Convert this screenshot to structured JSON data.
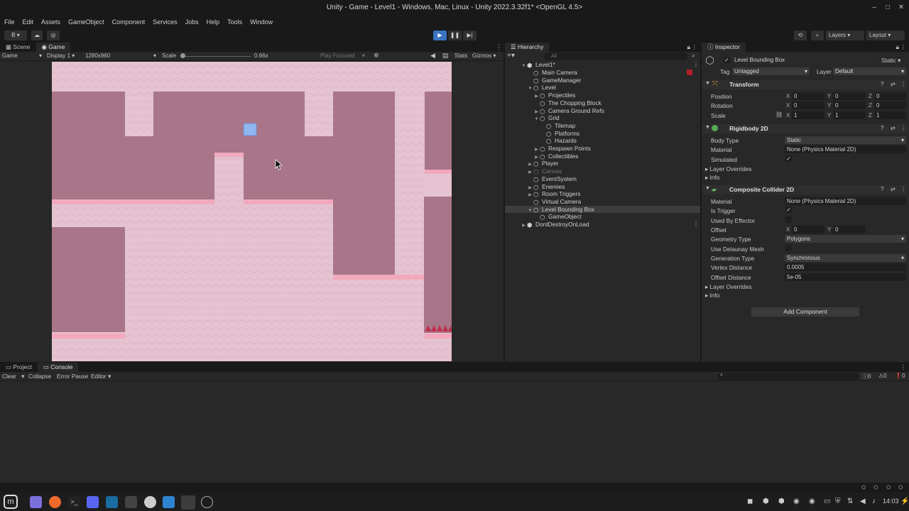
{
  "window": {
    "title": "Unity - Game - Level1 - Windows, Mac, Linux - Unity 2022.3.32f1* <OpenGL 4.5>",
    "minimize": "–",
    "maximize": "□",
    "close": "✕"
  },
  "menu": [
    "File",
    "Edit",
    "Assets",
    "GameObject",
    "Component",
    "Services",
    "Jobs",
    "Help",
    "Tools",
    "Window"
  ],
  "toolbar": {
    "account": "B",
    "layers": "Layers",
    "layout": "Layout"
  },
  "scene_tabs": {
    "scene": "Scene",
    "game": "Game"
  },
  "game_bar": {
    "mode": "Game",
    "display": "Display 1",
    "resolution": "1280x960",
    "scale_label": "Scale",
    "scale_value": "0.66x",
    "play_focused": "Play Focused",
    "stats": "Stats",
    "gizmos": "Gizmos"
  },
  "hierarchy": {
    "title": "Hierarchy",
    "search_placeholder": "All",
    "add": "+",
    "items": [
      "Level1*",
      "Main Camera",
      "GameManager",
      "Level",
      "Projectiles",
      "The Chopping Block",
      "Camera Ground Refs",
      "Grid",
      "Tilemap",
      "Platforms",
      "Hazards",
      "Respawn Points",
      "Collectibles",
      "Player",
      "Canvas",
      "EventSystem",
      "Enemies",
      "Room Triggers",
      "Virtual Camera",
      "Level Bounding Box",
      "GameObject",
      "DontDestroyOnLoad"
    ]
  },
  "inspector": {
    "title": "Inspector",
    "object_name": "Level Bounding Box",
    "static": "Static",
    "tag_label": "Tag",
    "tag_value": "Untagged",
    "layer_label": "Layer",
    "layer_value": "Default",
    "transform": {
      "title": "Transform",
      "position": "Position",
      "rotation": "Rotation",
      "scale": "Scale",
      "pos": [
        "0",
        "0",
        "0"
      ],
      "rot": [
        "0",
        "0",
        "0"
      ],
      "scl": [
        "1",
        "1",
        "1"
      ]
    },
    "rigidbody": {
      "title": "Rigidbody 2D",
      "body_type_label": "Body Type",
      "body_type": "Static",
      "material_label": "Material",
      "material": "None (Physics Material 2D)",
      "simulated_label": "Simulated",
      "layer_overrides": "Layer Overrides",
      "info": "Info"
    },
    "collider": {
      "title": "Composite Collider 2D",
      "material_label": "Material",
      "material": "None (Physics Material 2D)",
      "is_trigger": "Is Trigger",
      "used_by_effector": "Used By Effector",
      "offset": "Offset",
      "offset_x": "0",
      "offset_y": "0",
      "geometry_type_label": "Geometry Type",
      "geometry_type": "Polygons",
      "use_delaunay": "Use Delaunay Mesh",
      "generation_type_label": "Generation Type",
      "generation_type": "Synchronous",
      "vertex_distance_label": "Vertex Distance",
      "vertex_distance": "0.0005",
      "offset_distance_label": "Offset Distance",
      "offset_distance": "5e-05",
      "layer_overrides": "Layer Overrides",
      "info": "Info"
    },
    "add_component": "Add Component",
    "axis": [
      "X",
      "Y",
      "Z"
    ]
  },
  "bottom": {
    "project_tab": "Project",
    "console_tab": "Console",
    "clear": "Clear",
    "collapse": "Collapse",
    "error_pause": "Error Pause",
    "editor": "Editor",
    "counts": [
      "0",
      "0",
      "0"
    ]
  },
  "taskbar": {
    "time": "14:03"
  },
  "colors": {
    "bg": "#191919",
    "panel": "#282828",
    "game_light": "#e5c3d1",
    "game_dark": "#a87589",
    "accent": "#3a73c2"
  }
}
